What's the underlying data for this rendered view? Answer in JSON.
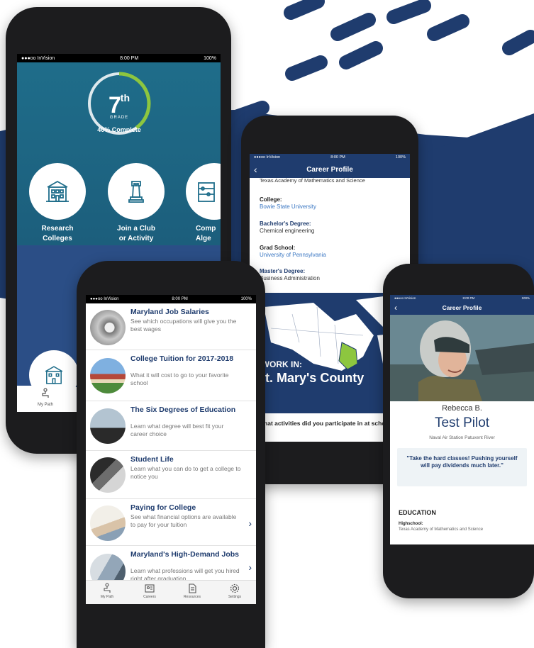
{
  "colors": {
    "navy": "#1f3c6e",
    "teal": "#1f6d8a",
    "link": "#3c78c3",
    "progress": "#8dc63f"
  },
  "status": {
    "carrier": "●●●oo InVision",
    "time": "8:00 PM",
    "battery": "100%"
  },
  "phone1": {
    "grade_number": "7",
    "grade_suffix": "th",
    "grade_label": "GRADE",
    "progress_percent": 40,
    "progress_text": "40% Complete",
    "actions": [
      {
        "label_line1": "Research",
        "label_line2": "Colleges",
        "icon": "building-icon"
      },
      {
        "label_line1": "Join a Club",
        "label_line2": "or Activity",
        "icon": "chess-piece-icon"
      },
      {
        "label_line1": "Comp",
        "label_line2": "Alge",
        "icon": "abacus-icon"
      }
    ],
    "tab_label": "My Path"
  },
  "phone2": {
    "items": [
      {
        "title": "Maryland Job Salaries",
        "desc": "See which occupations will give you the best wages",
        "chevron": false
      },
      {
        "title": "College Tuition for 2017-2018",
        "desc": "What it will cost to go to your favorite school",
        "chevron": false
      },
      {
        "title": "The Six Degrees of Education",
        "desc": "Learn what degree will best fit your career choice",
        "chevron": false
      },
      {
        "title": "Student Life",
        "desc": "Learn what you can do to get a college to notice you",
        "chevron": false
      },
      {
        "title": "Paying for College",
        "desc": "See what financial options are available to pay for your tuition",
        "chevron": true
      },
      {
        "title": "Maryland's High-Demand Jobs",
        "desc": "Learn what professions will get you hired right after graduation",
        "chevron": true
      }
    ],
    "tabs": [
      "My Path",
      "Careers",
      "Resources",
      "Settings"
    ]
  },
  "phone3": {
    "nav_title": "Career Profile",
    "school_partial": "Texas Academy of Mathematics and Science",
    "fields": [
      {
        "key": "College:",
        "value": "Bowie State University",
        "link": true
      },
      {
        "key": "Bachelor's Degree:",
        "value": "Chemical engineering",
        "link": false
      },
      {
        "key": "Grad School:",
        "value": "University of Pennsylvania",
        "link": true
      },
      {
        "key": "Master's Degree:",
        "value": "Business Administration",
        "link": false
      }
    ],
    "work_label": "I WORK IN:",
    "work_county": "St. Mary's County",
    "question": "What activities did you participate in at school?"
  },
  "phone4": {
    "nav_title": "Career Profile",
    "name": "Rebecca B.",
    "job_title": "Test Pilot",
    "location": "Naval Air Station Patuxent River",
    "quote": "\"Take the hard classes! Pushing yourself will pay dividends much later.\"",
    "section": "EDUCATION",
    "edu_key": "Highschool:",
    "edu_value": "Texas Academy of Mathematics and Science"
  }
}
